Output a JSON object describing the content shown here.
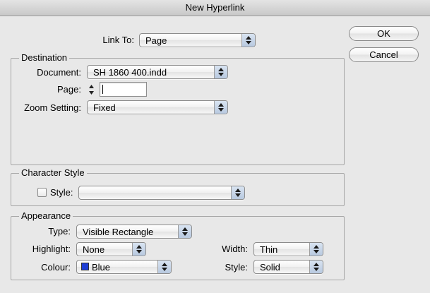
{
  "window": {
    "title": "New Hyperlink"
  },
  "buttons": {
    "ok": "OK",
    "cancel": "Cancel"
  },
  "link_to": {
    "label": "Link To:",
    "value": "Page"
  },
  "destination": {
    "legend": "Destination",
    "document_label": "Document:",
    "document_value": "SH 1860 400.indd",
    "page_label": "Page:",
    "page_value": "",
    "zoom_label": "Zoom Setting:",
    "zoom_value": "Fixed"
  },
  "character_style": {
    "legend": "Character Style",
    "style_label": "Style:",
    "style_checked": false,
    "style_value": ""
  },
  "appearance": {
    "legend": "Appearance",
    "type_label": "Type:",
    "type_value": "Visible Rectangle",
    "highlight_label": "Highlight:",
    "highlight_value": "None",
    "width_label": "Width:",
    "width_value": "Thin",
    "colour_label": "Colour:",
    "colour_value": "Blue",
    "colour_swatch": "#1f3fd6",
    "style_label": "Style:",
    "style_value": "Solid"
  },
  "icons": {
    "popup_arrows": "up-down-arrows-icon",
    "stepper": "stepper-arrows-icon"
  }
}
